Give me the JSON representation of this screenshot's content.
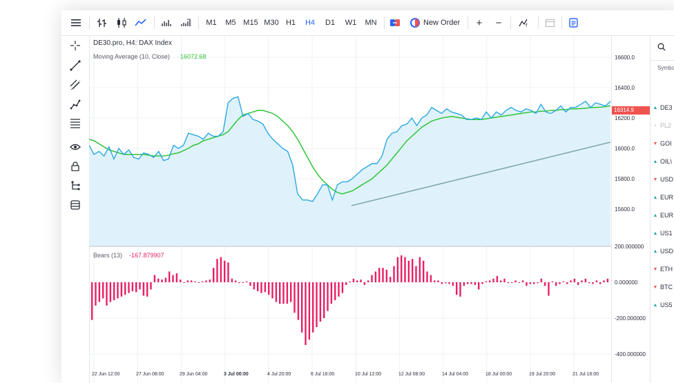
{
  "toolbar": {
    "timeframes": [
      "M1",
      "M5",
      "M15",
      "M30",
      "H1",
      "H4",
      "D1",
      "W1",
      "MN"
    ],
    "active_timeframe": "H4",
    "new_order_label": "New Order",
    "plus_label": "+",
    "minus_label": "−"
  },
  "main_chart": {
    "title": "DE30.pro, H4: DAX Index",
    "ma_label": "Moving Average (10, Close)",
    "ma_value": "16072.68",
    "price_ticks": [
      "16600.0",
      "16400.0",
      "16200.0",
      "16000.0",
      "15800.0",
      "15600.0"
    ],
    "current_price": "16314.9"
  },
  "indicator": {
    "label": "Bears (13)",
    "value": "-167.879907",
    "ticks": [
      "200.000000",
      "0.000000",
      "-200.000000",
      "-400.000000"
    ]
  },
  "x_labels": [
    "22 Jun 12:00",
    "27 Jun 08:00",
    "29 Jun 04:00",
    "3 Jul 00:00",
    "4 Jul 20:00",
    "6 Jul 16:00",
    "10 Jul 12:00",
    "12 Jul 08:00",
    "14 Jul 04:00",
    "18 Jul 00:00",
    "19 Jul 20:00",
    "21 Jul 16:00"
  ],
  "watchlist": {
    "header": "Symbo",
    "rows": [
      {
        "symbol": "DE3",
        "dir": "up"
      },
      {
        "symbol": "PL2",
        "dir": "flat"
      },
      {
        "symbol": "GOI",
        "dir": "down"
      },
      {
        "symbol": "OIL\\",
        "dir": "up"
      },
      {
        "symbol": "USD",
        "dir": "down"
      },
      {
        "symbol": "EUR",
        "dir": "up"
      },
      {
        "symbol": "EUR",
        "dir": "up"
      },
      {
        "symbol": "US1",
        "dir": "up"
      },
      {
        "symbol": "USD",
        "dir": "up"
      },
      {
        "symbol": "ETH",
        "dir": "down"
      },
      {
        "symbol": "BTC",
        "dir": "down"
      },
      {
        "symbol": "US5",
        "dir": "up"
      }
    ]
  },
  "colors": {
    "price_line": "#29a8e0",
    "ma_line": "#2ec436",
    "area_fill": "#dff2fb",
    "trend_line": "#7fa6a8",
    "bears_bar": "#e91e63",
    "up": "#26a69a",
    "down": "#ef5350",
    "accent": "#2962ff"
  },
  "chart_data": [
    {
      "type": "line",
      "title": "DE30.pro, H4: DAX Index",
      "ylim": [
        15500,
        16700
      ],
      "series": [
        {
          "name": "DE30.pro, H4: DAX Index",
          "values": [
            16020,
            15960,
            15980,
            15950,
            16010,
            15930,
            16000,
            15960,
            15990,
            15940,
            15930,
            15970,
            15960,
            15940,
            15980,
            15920,
            15930,
            16020,
            16000,
            16020,
            16100,
            16090,
            16080,
            16060,
            16100,
            16080,
            16080,
            16110,
            16300,
            16330,
            16340,
            16210,
            16230,
            16190,
            16180,
            16160,
            16100,
            16060,
            16030,
            16000,
            15980,
            15890,
            15700,
            15660,
            15660,
            15650,
            15700,
            15760,
            15760,
            15660,
            15760,
            15780,
            15780,
            15800,
            15830,
            15860,
            15880,
            15900,
            15900,
            15950,
            16060,
            16100,
            16110,
            16150,
            16160,
            16200,
            16150,
            16200,
            16220,
            16270,
            16250,
            16230,
            16260,
            16240,
            16230,
            16220,
            16190,
            16190,
            16200,
            16190,
            16240,
            16200,
            16240,
            16220,
            16250,
            16270,
            16250,
            16240,
            16260,
            16250,
            16230,
            16290,
            16240,
            16230,
            16250,
            16280,
            16240,
            16270,
            16270,
            16290,
            16310,
            16270,
            16300,
            16290,
            16280,
            16310
          ]
        },
        {
          "name": "Moving Average (10, Close)",
          "values": [
            16060,
            16050,
            16030,
            16010,
            15990,
            15980,
            15970,
            15960,
            15960,
            15960,
            15960,
            15960,
            15955,
            15950,
            15950,
            15950,
            15955,
            15965,
            15970,
            15985,
            16000,
            16020,
            16030,
            16050,
            16060,
            16070,
            16080,
            16090,
            16110,
            16150,
            16190,
            16220,
            16230,
            16240,
            16250,
            16250,
            16240,
            16230,
            16210,
            16180,
            16150,
            16110,
            16060,
            16000,
            15940,
            15880,
            15830,
            15790,
            15760,
            15730,
            15710,
            15700,
            15710,
            15720,
            15740,
            15760,
            15780,
            15800,
            15830,
            15860,
            15890,
            15930,
            15970,
            16010,
            16050,
            16080,
            16110,
            16140,
            16160,
            16180,
            16190,
            16200,
            16205,
            16210,
            16205,
            16200,
            16195,
            16190,
            16190,
            16190,
            16195,
            16200,
            16205,
            16210,
            16215,
            16220,
            16225,
            16230,
            16235,
            16240,
            16240,
            16245,
            16245,
            16250,
            16250,
            16255,
            16255,
            16260,
            16260,
            16262,
            16265,
            16268,
            16270,
            16272,
            16275,
            16280
          ]
        }
      ],
      "annotations": [
        "trend line"
      ]
    },
    {
      "type": "bar",
      "title": "Bears (13)",
      "ylim": [
        -450,
        250
      ],
      "series": [
        {
          "name": "Bears (13)",
          "values": [
            -210,
            -130,
            -110,
            -90,
            -130,
            -110,
            -100,
            -90,
            -80,
            -70,
            -60,
            -50,
            -55,
            -40,
            -75,
            -80,
            -40,
            40,
            20,
            15,
            25,
            60,
            40,
            50,
            15,
            0,
            10,
            10,
            5,
            0,
            5,
            10,
            15,
            80,
            130,
            140,
            120,
            110,
            20,
            10,
            -5,
            0,
            5,
            -20,
            -40,
            -50,
            -60,
            -55,
            -70,
            -90,
            -110,
            -120,
            -120,
            -120,
            -110,
            -170,
            -210,
            -280,
            -350,
            -320,
            -280,
            -250,
            -220,
            -200,
            -160,
            -120,
            -100,
            -80,
            -60,
            -15,
            5,
            20,
            10,
            15,
            -15,
            10,
            40,
            60,
            80,
            80,
            70,
            30,
            90,
            140,
            150,
            140,
            120,
            130,
            90,
            140,
            120,
            60,
            40,
            10,
            10,
            -10,
            -5,
            -10,
            -20,
            -70,
            -80,
            -20,
            -10,
            -10,
            -15,
            -40,
            -10,
            5,
            10,
            20,
            35,
            10,
            20,
            -5,
            0,
            10,
            0,
            10,
            -20,
            -10,
            -10,
            -5,
            20,
            -20,
            -75,
            5,
            -20,
            -10,
            5,
            -10,
            10,
            20,
            -15,
            10,
            20,
            -5,
            -10,
            10,
            -10,
            10,
            20
          ]
        }
      ]
    }
  ]
}
